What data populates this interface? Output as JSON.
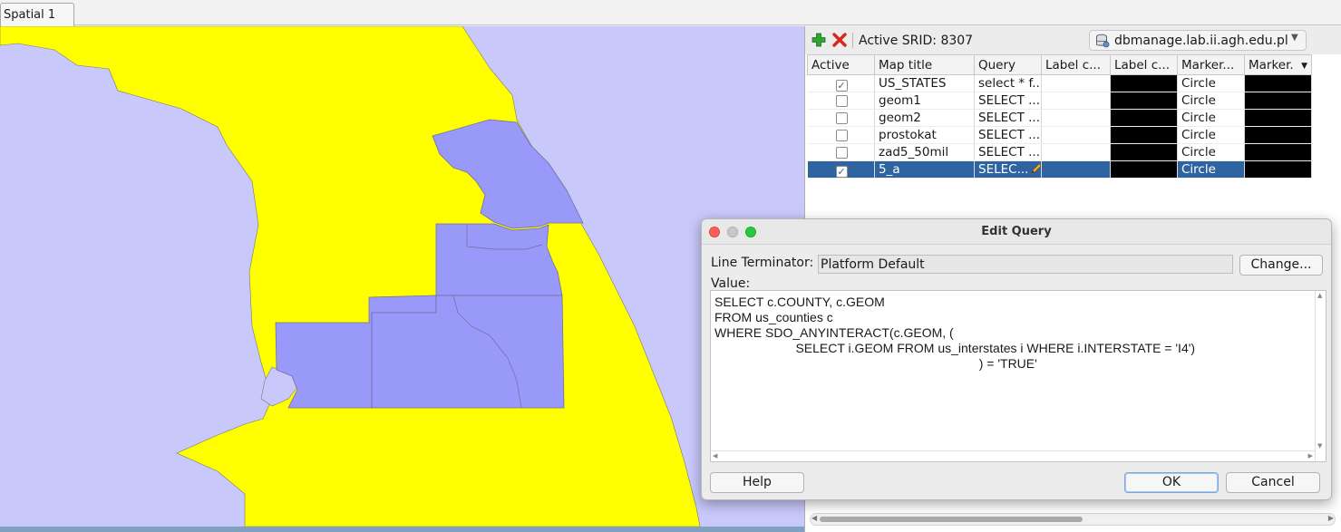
{
  "tabs": [
    {
      "label": "Spatial 1"
    }
  ],
  "toolbar": {
    "add_icon": "green-plus-icon",
    "remove_icon": "red-x-icon",
    "srid_label": "Active SRID: 8307",
    "connection": "dbmanage.lab.ii.agh.edu.pl",
    "db_icon": "database-icon"
  },
  "layer_table": {
    "columns": [
      "Active",
      "Map title",
      "Query",
      "Label c...",
      "Label c...",
      "Marker...",
      "Marker."
    ],
    "rows": [
      {
        "active": true,
        "title": "US_STATES",
        "query": "select * f...",
        "marker": "Circle"
      },
      {
        "active": false,
        "title": "geom1",
        "query": "SELECT ...",
        "marker": "Circle"
      },
      {
        "active": false,
        "title": "geom2",
        "query": "SELECT ...",
        "marker": "Circle"
      },
      {
        "active": false,
        "title": "prostokat",
        "query": "SELECT  ...",
        "marker": "Circle"
      },
      {
        "active": false,
        "title": "zad5_50mil",
        "query": "SELECT ...",
        "marker": "Circle"
      },
      {
        "active": true,
        "title": "5_a",
        "query": "SELEC...",
        "marker": "Circle",
        "selected": true
      }
    ]
  },
  "map": {
    "background_color": "#c8c8fa",
    "land_color": "#ffff00",
    "highlight_color": "#9999fa"
  },
  "dialog": {
    "title": "Edit Query",
    "line_terminator_label": "Line Terminator:",
    "line_terminator_value": "Platform Default",
    "change_button": "Change...",
    "value_label": "Value:",
    "query_text": "SELECT c.COUNTY, c.GEOM\nFROM us_counties c\nWHERE SDO_ANYINTERACT(c.GEOM, (\n                       SELECT i.GEOM FROM us_interstates i WHERE i.INTERSTATE = 'I4')\n                                                                           ) = 'TRUE'",
    "help_button": "Help",
    "ok_button": "OK",
    "cancel_button": "Cancel"
  }
}
